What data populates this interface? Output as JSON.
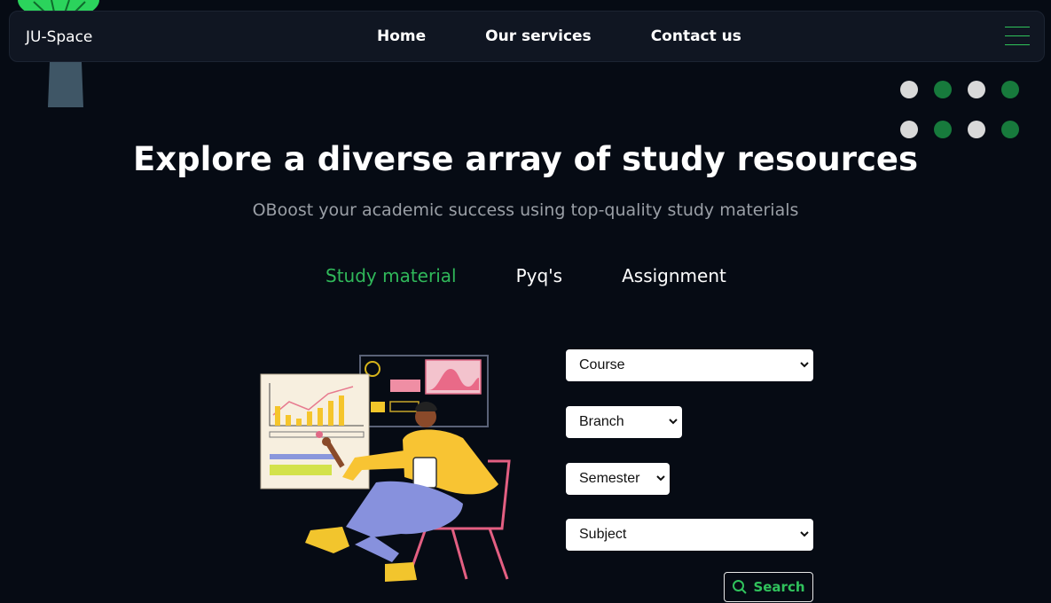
{
  "navbar": {
    "brand": "JU-Space",
    "links": [
      "Home",
      "Our services",
      "Contact us"
    ]
  },
  "hero": {
    "title": "Explore a diverse array of study resources",
    "subtitle": "OBoost your academic success using top-quality study materials"
  },
  "tabs": [
    {
      "label": "Study material",
      "active": true
    },
    {
      "label": "Pyq's",
      "active": false
    },
    {
      "label": "Assignment",
      "active": false
    }
  ],
  "form": {
    "course": "Course",
    "branch": "Branch",
    "semester": "Semester",
    "subject": "Subject",
    "search_label": "Search"
  },
  "colors": {
    "background": "#060b14",
    "accent_green": "#30b85a",
    "dot_green": "#177a3c",
    "dot_grey": "#d9d9d9"
  }
}
